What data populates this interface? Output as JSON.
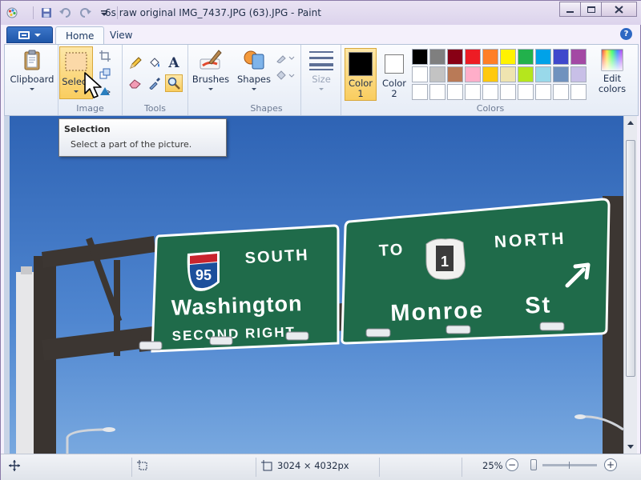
{
  "window": {
    "title": "6s raw original IMG_7437.JPG (63).JPG - Paint",
    "controls": [
      "minimize",
      "maximize",
      "close"
    ]
  },
  "quick_access": [
    "save-icon",
    "undo-icon",
    "redo-icon",
    "customize-arrow-icon"
  ],
  "ribbon": {
    "app_menu_icon": "paint-menu-icon",
    "tabs": [
      {
        "label": "Home",
        "active": true
      },
      {
        "label": "View",
        "active": false
      }
    ],
    "groups": {
      "clipboard": {
        "label": "Clipboard"
      },
      "image": {
        "label": "Image",
        "select_label": "Select"
      },
      "tools": {
        "label": "Tools"
      },
      "brushes": {
        "label": "Brushes"
      },
      "shapes": {
        "label": "Shapes",
        "shapes_button": "Shapes"
      },
      "size": {
        "label": "Size"
      },
      "colors": {
        "label": "Colors",
        "color1_label": "Color 1",
        "color2_label": "Color 2",
        "edit_colors_label": "Edit colors",
        "color1": "#000000",
        "color2": "#ffffff",
        "palette": [
          "#000000",
          "#7f7f7f",
          "#880015",
          "#ed1c24",
          "#ff7f27",
          "#fff200",
          "#22b14c",
          "#00a2e8",
          "#3f48cc",
          "#a349a4",
          "#ffffff",
          "#c3c3c3",
          "#b97a57",
          "#ffaec9",
          "#ffc90e",
          "#efe4b0",
          "#b5e61d",
          "#99d9ea",
          "#7092be",
          "#c8bfe7",
          "#ffffff",
          "#ffffff",
          "#ffffff",
          "#ffffff",
          "#ffffff",
          "#ffffff",
          "#ffffff",
          "#ffffff",
          "#ffffff",
          "#ffffff"
        ]
      }
    }
  },
  "tooltip": {
    "title": "Selection",
    "description": "Select a part of the picture."
  },
  "photo": {
    "left_sign": {
      "shield": "95",
      "direction": "SOUTH",
      "street": "Washington",
      "sub": "SECOND RIGHT"
    },
    "right_sign": {
      "word_to": "TO",
      "shield": "1",
      "direction": "NORTH",
      "street": "Monroe",
      "suffix": "St"
    }
  },
  "status": {
    "dimensions": "3024 × 4032px",
    "zoom": "25%"
  }
}
